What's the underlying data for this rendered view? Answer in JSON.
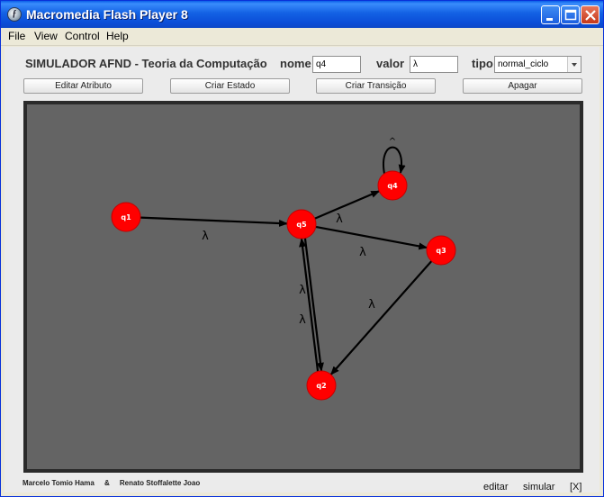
{
  "window": {
    "title": "Macromedia Flash Player 8"
  },
  "menu": [
    "File",
    "View",
    "Control",
    "Help"
  ],
  "header": {
    "title": "SIMULADOR AFND - Teoria da Computação",
    "nome_label": "nome",
    "nome_value": "q4",
    "valor_label": "valor",
    "valor_value": "λ",
    "tipo_label": "tipo",
    "tipo_value": "normal_ciclo"
  },
  "toolbar": {
    "editar_atributo": "Editar Atributo",
    "criar_estado": "Criar Estado",
    "criar_transicao": "Criar Transição",
    "apagar": "Apagar"
  },
  "automaton": {
    "states": [
      {
        "id": "q1",
        "label": "q1"
      },
      {
        "id": "q5",
        "label": "q5"
      },
      {
        "id": "q4",
        "label": "q4"
      },
      {
        "id": "q3",
        "label": "q3"
      },
      {
        "id": "q2",
        "label": "q2"
      }
    ],
    "transitions": [
      {
        "from": "q1",
        "to": "q5",
        "label": "λ"
      },
      {
        "from": "q5",
        "to": "q4",
        "label": "λ"
      },
      {
        "from": "q5",
        "to": "q3",
        "label": "λ"
      },
      {
        "from": "q3",
        "to": "q2",
        "label": "λ"
      },
      {
        "from": "q5",
        "to": "q2",
        "label": "λ"
      },
      {
        "from": "q2",
        "to": "q5",
        "label": "λ"
      },
      {
        "from": "q4",
        "to": "q4",
        "label": "^"
      }
    ],
    "colors": {
      "state_fill": "#ff0000",
      "state_stroke": "#c40000",
      "edge": "#000000",
      "background": "#646464"
    }
  },
  "footer": {
    "author1": "Marcelo Tomio Hama",
    "separator": "&",
    "author2": "Renato Stoffalette Joao",
    "editar": "editar",
    "simular": "simular",
    "close": "[X]"
  }
}
